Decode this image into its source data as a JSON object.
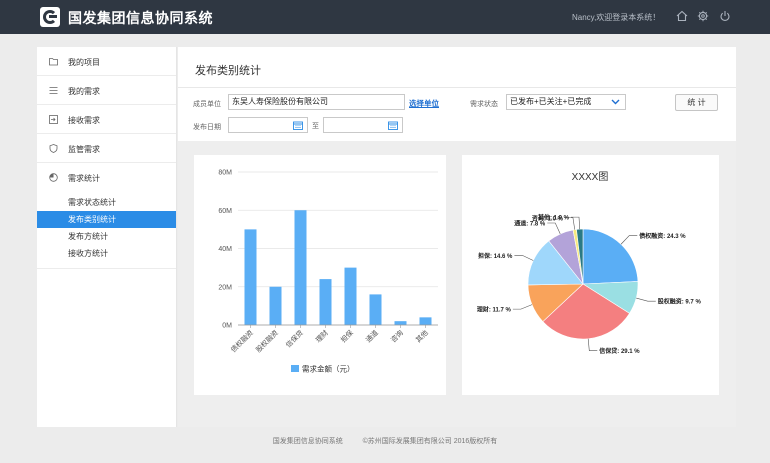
{
  "header": {
    "app_title": "国发集团信息协同系统",
    "welcome_text": "Nancy,欢迎登录本系统！",
    "icons": [
      "home-icon",
      "gear-icon",
      "power-icon"
    ]
  },
  "sidebar": {
    "items": [
      {
        "label": "我的项目",
        "icon": "folder-icon"
      },
      {
        "label": "我的需求",
        "icon": "list-icon"
      },
      {
        "label": "接收需求",
        "icon": "inbox-icon"
      },
      {
        "label": "监管需求",
        "icon": "shield-icon"
      },
      {
        "label": "需求统计",
        "icon": "pie-icon"
      }
    ],
    "sub_items": [
      {
        "label": "需求状态统计",
        "active": false
      },
      {
        "label": "发布类别统计",
        "active": true
      },
      {
        "label": "发布方统计",
        "active": false
      },
      {
        "label": "接收方统计",
        "active": false
      }
    ]
  },
  "main": {
    "page_title": "发布类别统计",
    "filters": {
      "member_label": "成员单位",
      "member_value": "东吴人寿保险股份有限公司",
      "select_unit_link": "选择单位",
      "status_label": "需求状态",
      "status_value": "已发布+已关注+已完成",
      "date_label": "发布日期",
      "date_to": "至",
      "date_from_value": "",
      "date_to_value": "",
      "stat_button": "统 计"
    }
  },
  "chart_data": [
    {
      "type": "bar",
      "categories": [
        "债权融资",
        "股权融资",
        "信保贷",
        "理财",
        "担保",
        "通道",
        "咨询",
        "其他"
      ],
      "values": [
        50,
        20,
        60,
        24,
        30,
        16,
        2,
        4
      ],
      "y_tick_labels": [
        "0M",
        "20M",
        "40M",
        "60M",
        "80M"
      ],
      "ylim": [
        0,
        80
      ],
      "legend": "需求金额（元）",
      "legend_placement": "bottom",
      "grid": true,
      "color": "#5aaef5"
    },
    {
      "type": "pie",
      "title": "XXXX图",
      "slices": [
        {
          "label": "债权融资: 24.3 %",
          "value": 24.3,
          "color": "#5aaef5"
        },
        {
          "label": "股权融资: 9.7 %",
          "value": 9.7,
          "color": "#9adfe3"
        },
        {
          "label": "信保贷: 29.1 %",
          "value": 29.1,
          "color": "#f47f80"
        },
        {
          "label": "理财: 11.7 %",
          "value": 11.7,
          "color": "#f9a35b"
        },
        {
          "label": "担保: 14.6 %",
          "value": 14.6,
          "color": "#9fd7fb"
        },
        {
          "label": "通道: 7.8 %",
          "value": 7.8,
          "color": "#b3a3d9"
        },
        {
          "label": "咨询: 1.0 %",
          "value": 1.0,
          "color": "#f7e97d"
        },
        {
          "label": "其他: 1.9 %",
          "value": 1.9,
          "color": "#2a7a85"
        }
      ]
    }
  ],
  "footer": {
    "system_name": "国发集团信息协同系统",
    "copyright": "©苏州国际发展集团有限公司 2016版权所有"
  }
}
